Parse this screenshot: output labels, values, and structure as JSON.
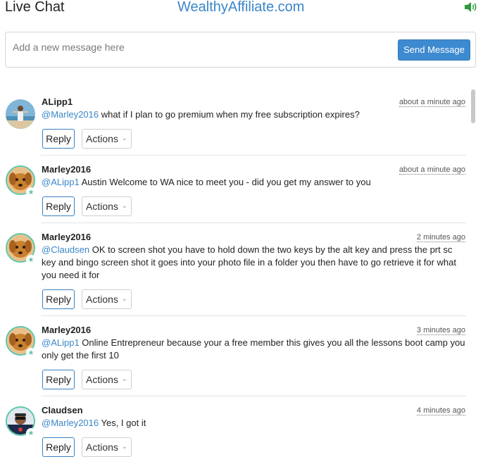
{
  "header": {
    "title": "Live Chat",
    "site_name": "WealthyAffiliate.com",
    "sound_icon": "speaker-volume-icon"
  },
  "composer": {
    "placeholder": "Add a new message here",
    "value": "",
    "send_label": "Send Message"
  },
  "colors": {
    "link": "#3a86c8",
    "send_button": "#3d8ad0",
    "avatar_ring": "#5cc5a8"
  },
  "messages": [
    {
      "username": "ALipp1",
      "time": "about a minute ago",
      "mention": "@Marley2016",
      "text": " what if I plan to go premium when my free subscription expires?",
      "reply_label": "Reply",
      "actions_label": "Actions",
      "avatar": "photo-person-beach"
    },
    {
      "username": "Marley2016",
      "time": "about a minute ago",
      "mention": "@ALipp1",
      "text": " Austin Welcome to WA nice to meet you - did you get my answer to you",
      "reply_label": "Reply",
      "actions_label": "Actions",
      "avatar": "photo-golden-retriever-puppy"
    },
    {
      "username": "Marley2016",
      "time": "2 minutes ago",
      "mention": "@Claudsen",
      "text": " OK to screen shot you have to hold down the two keys by the alt key and press the prt sc key and bingo screen shot it goes into your photo file in a folder you then have to go retrieve it for what you need it for",
      "reply_label": "Reply",
      "actions_label": "Actions",
      "avatar": "photo-golden-retriever-puppy"
    },
    {
      "username": "Marley2016",
      "time": "3 minutes ago",
      "mention": "@ALipp1",
      "text": " Online Entrepreneur because your a free member this gives you all the lessons boot camp you only get the first 10",
      "reply_label": "Reply",
      "actions_label": "Actions",
      "avatar": "photo-golden-retriever-puppy"
    },
    {
      "username": "Claudsen",
      "time": "4 minutes ago",
      "mention": "@Marley2016",
      "text": " Yes, I got it",
      "reply_label": "Reply",
      "actions_label": "Actions",
      "avatar": "photo-man-sunglasses"
    }
  ]
}
